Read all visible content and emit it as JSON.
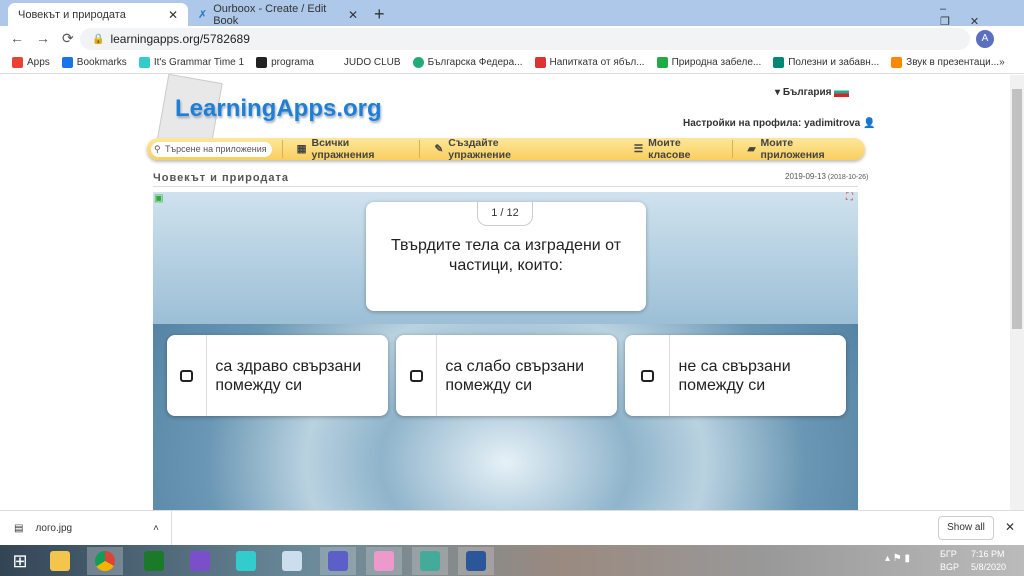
{
  "browser": {
    "tabs": [
      {
        "title": "Човекът и природата"
      },
      {
        "title": "Ourboox - Create / Edit Book"
      }
    ],
    "new_tab": "+",
    "url": "learningapps.org/5782689",
    "bookmarks": [
      {
        "label": "Apps",
        "color": "#e94235"
      },
      {
        "label": "Bookmarks",
        "color": "#1a73e8"
      },
      {
        "label": "It's Grammar Time 1",
        "color": "#3cc"
      },
      {
        "label": "programa",
        "color": "#222"
      },
      {
        "label": "JUDO CLUB",
        "color": "#fff"
      },
      {
        "label": "Българска Федера...",
        "color": "#2a7"
      },
      {
        "label": "Напитката от ябъл...",
        "color": "#d33"
      },
      {
        "label": "Природна забеле...",
        "color": "#2a4"
      },
      {
        "label": "Полезни и забавн...",
        "color": "#087"
      },
      {
        "label": "Звук в презентаци...",
        "color": "#f80"
      }
    ],
    "more": "»"
  },
  "site": {
    "logo": "LearningApps.org",
    "language": "България",
    "profile": "Настройки на профила: yadimitrova",
    "search_placeholder": "Търсене на приложения",
    "nav": [
      "Всички упражнения",
      "Създайте упражнение",
      "Моите класове",
      "Моите приложения"
    ],
    "title": "Човекът и природата",
    "date": "2019-09-13",
    "date2": "(2018-10-26)"
  },
  "quiz": {
    "counter": "1 / 12",
    "question": "Твърдите тела са изградени от частици, които:",
    "answers": [
      "са здраво свързани помежду си",
      "са слабо свързани помежду си",
      "не са свързани помежду си"
    ]
  },
  "downloads": {
    "file": "лого.jpg",
    "show_all": "Show all"
  },
  "taskbar": {
    "lang1": "БГР",
    "lang2": "BGP",
    "time": "7:16 PM",
    "date": "5/8/2020"
  }
}
